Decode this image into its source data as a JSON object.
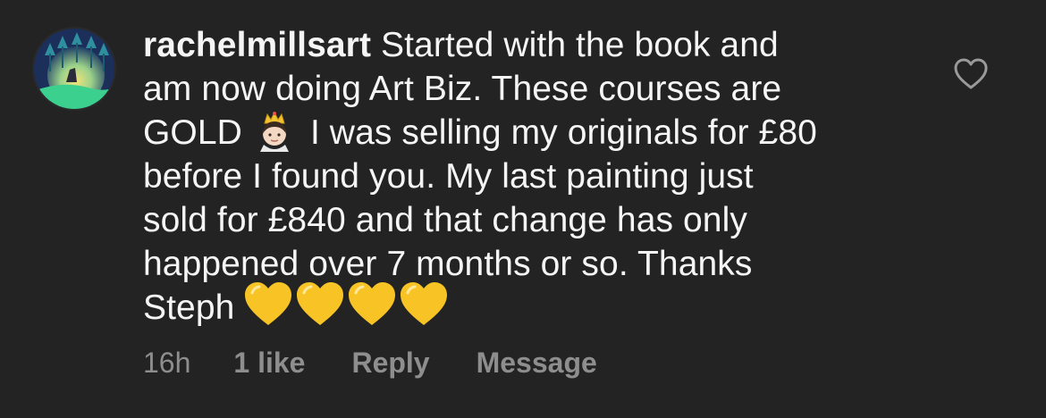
{
  "comment": {
    "username": "rachelmillsart",
    "lines": [
      "Started with the book and",
      "am now doing Art Biz. These courses are",
      "GOLD",
      "I was selling my originals for £80",
      "before I found you. My last painting just",
      "sold for £840 and that change has only",
      "happened over 7 months or so. Thanks",
      "Steph"
    ],
    "emojis": {
      "after_gold": "crowned-person-emoji",
      "after_steph": [
        "yellow-heart-emoji",
        "yellow-heart-emoji",
        "yellow-heart-emoji",
        "yellow-heart-emoji"
      ]
    },
    "meta": {
      "time": "16h",
      "likes": "1 like",
      "reply": "Reply",
      "message": "Message"
    },
    "like_icon": "heart-outline-icon",
    "colors": {
      "background": "#232323",
      "text": "#f5f5f5",
      "meta": "#8e8e8e",
      "heart_emoji": "#f7c325"
    }
  }
}
